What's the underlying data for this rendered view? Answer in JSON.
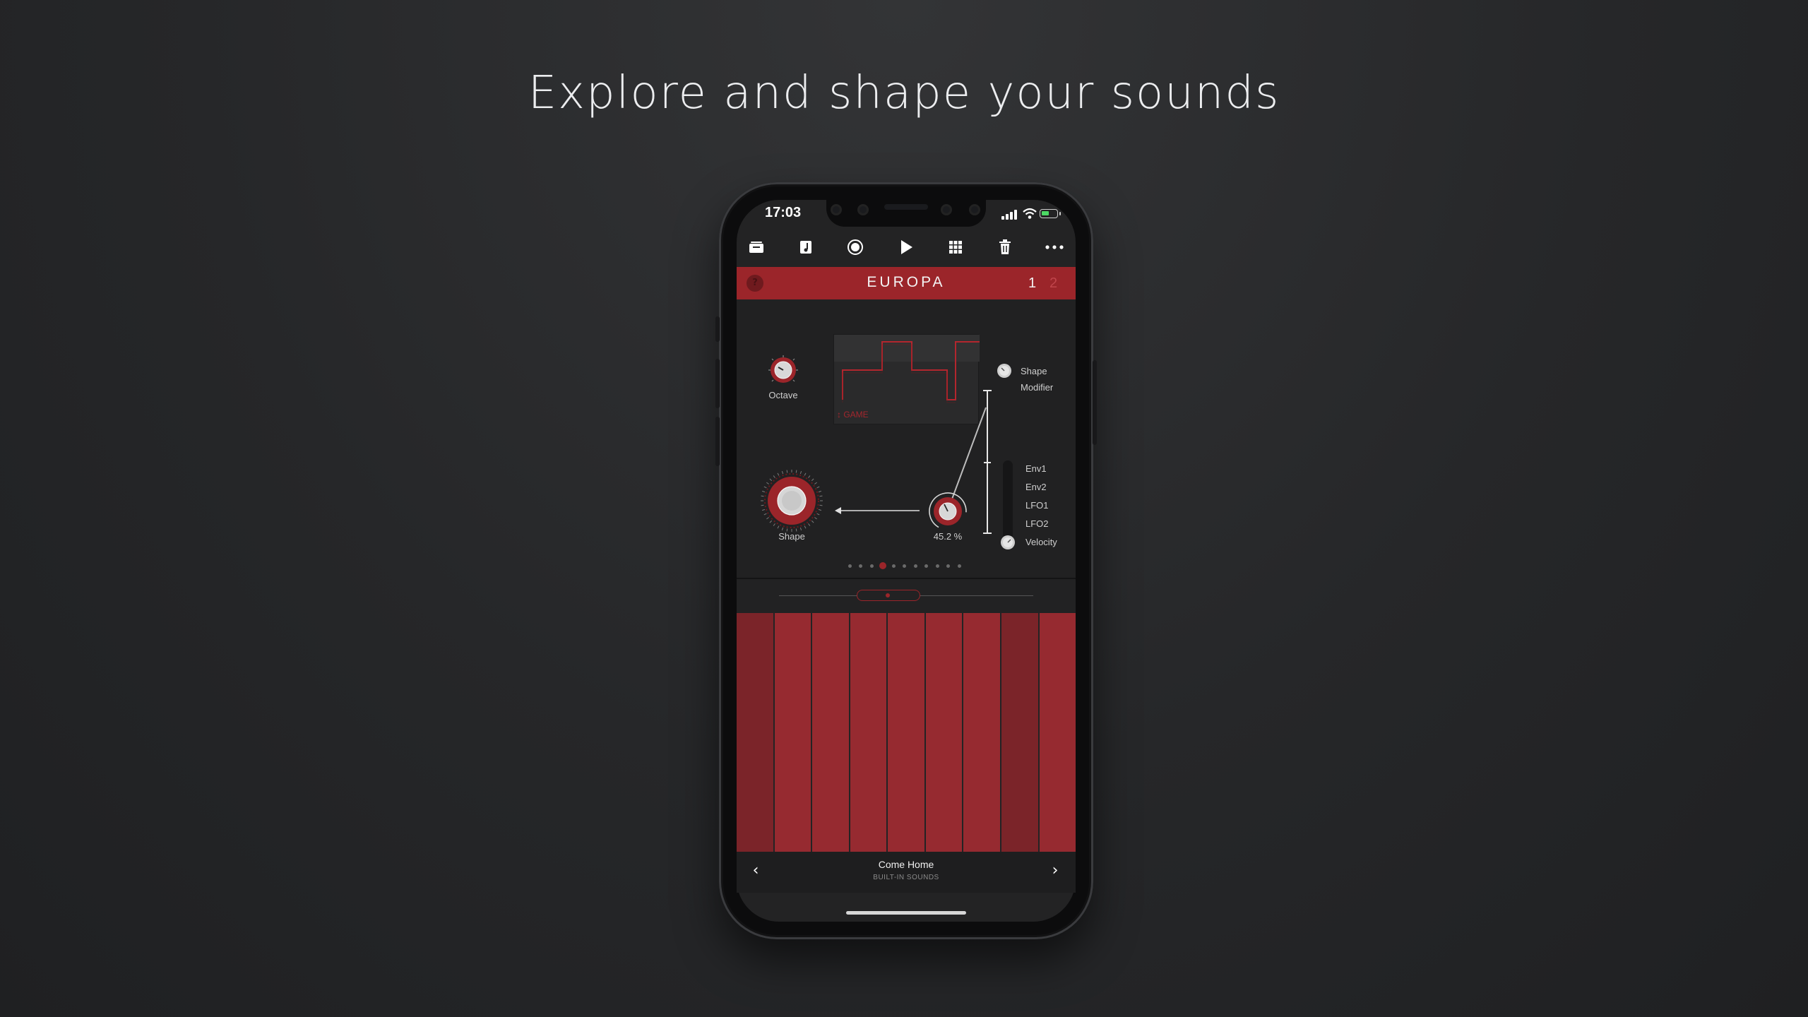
{
  "headline": "Explore and shape your sounds",
  "status": {
    "time": "17:03"
  },
  "toolbar": {
    "icons": [
      "inbox-icon",
      "music-note-icon",
      "record-icon",
      "play-icon",
      "grid-icon",
      "trash-icon",
      "more-icon"
    ]
  },
  "instrument": {
    "help_label": "?",
    "name": "EUROPA",
    "pages": [
      "1",
      "2"
    ],
    "active_page": "1"
  },
  "panel": {
    "octave_label": "Octave",
    "shape_label": "Shape",
    "mod_amount": "45.2 %",
    "waveform_mode": "↕ GAME",
    "targets": [
      "Shape",
      "Modifier"
    ],
    "sources": [
      "Env1",
      "Env2",
      "LFO1",
      "LFO2",
      "Velocity"
    ],
    "page_dots": 11,
    "active_dot": 3
  },
  "keyboard": {
    "key_count": 9
  },
  "preset": {
    "name": "Come Home",
    "category": "BUILT-IN SOUNDS",
    "prev_label": "‹",
    "next_label": "›"
  },
  "colors": {
    "accent": "#9b252a",
    "key_red": "#962a30",
    "key_dark": "#7b2429",
    "background": "#2a2b2d"
  }
}
